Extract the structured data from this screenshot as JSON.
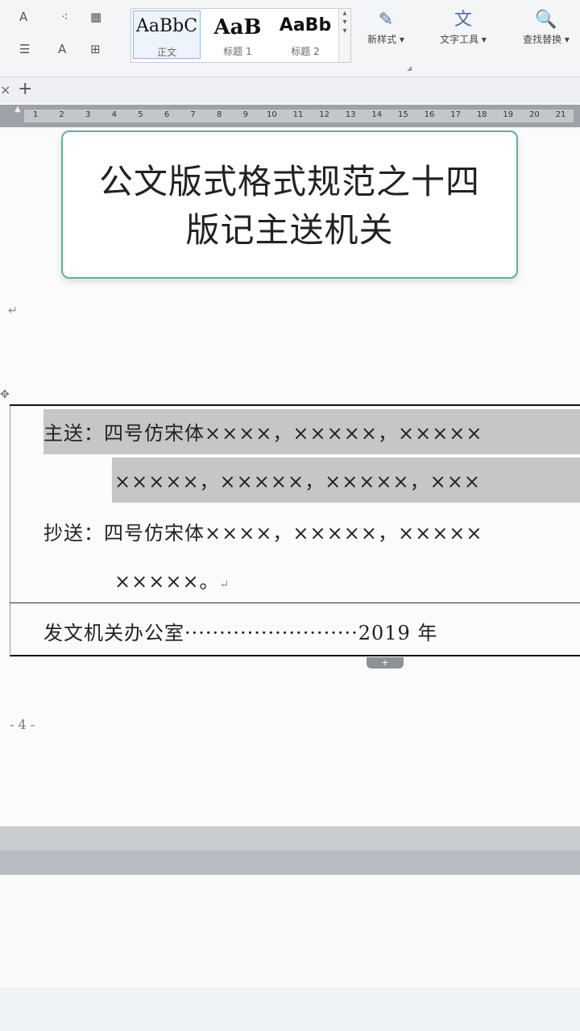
{
  "ribbon": {
    "mini_tools": [
      "A",
      "⁖",
      "▦",
      "☰",
      "A",
      "⊞"
    ],
    "styles": [
      {
        "preview": "AaBbC",
        "name": "正文"
      },
      {
        "preview": "AaB",
        "name": "标题 1"
      },
      {
        "preview": "AaBb",
        "name": "标题 2"
      }
    ],
    "new_style_label": "新样式 ▾",
    "text_tools_label": "文字工具 ▾",
    "find_replace_label": "查找替换 ▾"
  },
  "tabs": {
    "close": "×",
    "add": "+"
  },
  "ruler": {
    "numbers": [
      "1",
      "2",
      "3",
      "4",
      "5",
      "6",
      "7",
      "8",
      "9",
      "10",
      "11",
      "12",
      "13",
      "14",
      "15",
      "16",
      "17",
      "18",
      "19",
      "20",
      "21"
    ]
  },
  "callout": {
    "line1": "公文版式格式规范之十四",
    "line2": "版记主送机关"
  },
  "document": {
    "zhusong_label": "主送：",
    "zhusong_line1": "四号仿宋体××××，×××××，×××××",
    "zhusong_line2": "×××××，×××××，×××××，×××",
    "chaosong_label": "抄送：",
    "chaosong_line1": "四号仿宋体××××，×××××，×××××",
    "chaosong_line2": "×××××。",
    "issuer_line": "发文机关办公室·························2019 年",
    "page_number": "- 4 -",
    "para_mark": "↵"
  }
}
